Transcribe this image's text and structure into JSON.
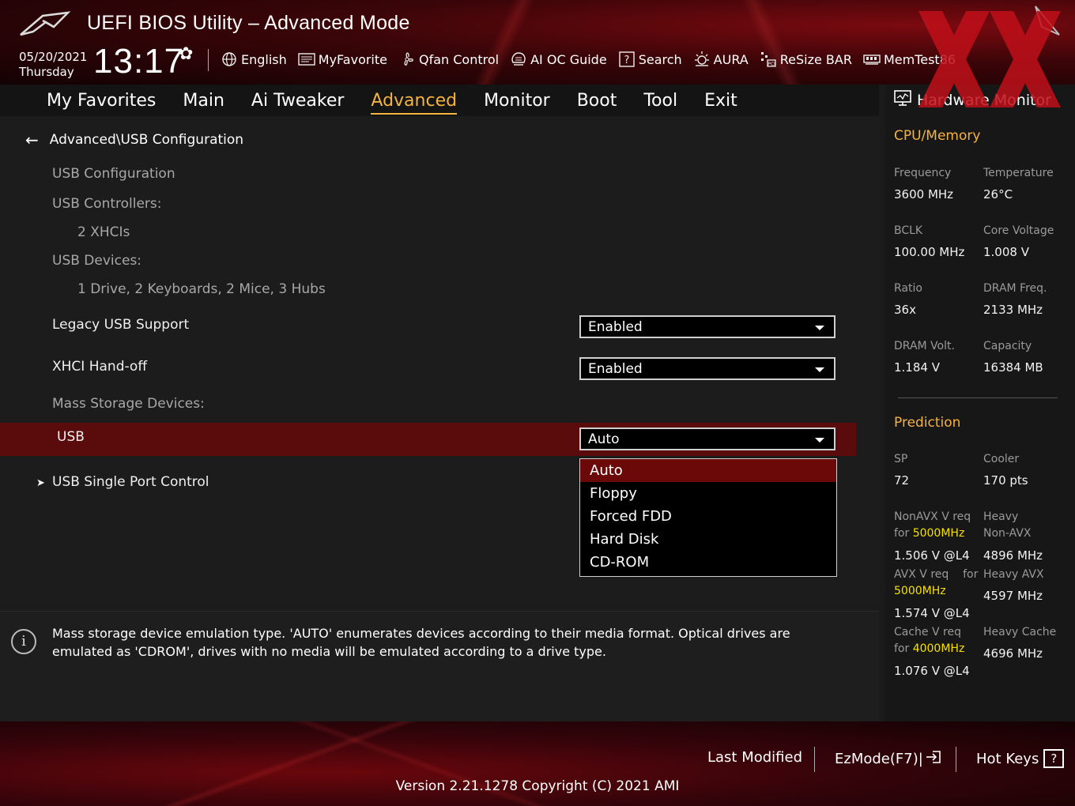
{
  "header": {
    "title": "UEFI BIOS Utility – Advanced Mode",
    "date": "05/20/2021",
    "day": "Thursday",
    "time": "13:17",
    "tools": [
      {
        "label": "English",
        "icon": "globe-icon"
      },
      {
        "label": "MyFavorite",
        "icon": "favorite-icon"
      },
      {
        "label": "Qfan Control",
        "icon": "fan-icon"
      },
      {
        "label": "AI OC Guide",
        "icon": "ai-guide-icon"
      },
      {
        "label": "Search",
        "icon": "search-icon"
      },
      {
        "label": "AURA",
        "icon": "aura-icon"
      },
      {
        "label": "ReSize BAR",
        "icon": "resize-bar-icon"
      },
      {
        "label": "MemTest86",
        "icon": "memtest-icon"
      }
    ]
  },
  "tabs": [
    {
      "label": "My Favorites",
      "active": false
    },
    {
      "label": "Main",
      "active": false
    },
    {
      "label": "Ai Tweaker",
      "active": false
    },
    {
      "label": "Advanced",
      "active": true
    },
    {
      "label": "Monitor",
      "active": false
    },
    {
      "label": "Boot",
      "active": false
    },
    {
      "label": "Tool",
      "active": false
    },
    {
      "label": "Exit",
      "active": false
    }
  ],
  "main": {
    "breadcrumb": "Advanced\\USB Configuration",
    "usb_configuration": "USB Configuration",
    "usb_controllers_label": "USB Controllers:",
    "usb_controllers_value": "2 XHCIs",
    "usb_devices_label": "USB Devices:",
    "usb_devices_value": "1 Drive, 2 Keyboards, 2 Mice, 3 Hubs",
    "legacy_usb": {
      "label": "Legacy USB Support",
      "value": "Enabled"
    },
    "xhci_handoff": {
      "label": "XHCI Hand-off",
      "value": "Enabled"
    },
    "mass_storage_label": "Mass Storage Devices:",
    "usb": {
      "label": "USB",
      "value": "Auto"
    },
    "usb_options": [
      "Auto",
      "Floppy",
      "Forced FDD",
      "Hard Disk",
      "CD-ROM"
    ],
    "usb_single_port": "USB Single Port Control"
  },
  "help": {
    "text": "Mass storage device emulation type. 'AUTO' enumerates devices according to their media format. Optical drives are emulated as 'CDROM', drives with no media will be emulated according to a drive type."
  },
  "hardware_monitor": {
    "title": "Hardware Monitor",
    "cpu_memory": {
      "title": "CPU/Memory",
      "frequency_label": "Frequency",
      "frequency": "3600 MHz",
      "temperature_label": "Temperature",
      "temperature": "26°C",
      "bclk_label": "BCLK",
      "bclk": "100.00 MHz",
      "core_voltage_label": "Core Voltage",
      "core_voltage": "1.008 V",
      "ratio_label": "Ratio",
      "ratio": "36x",
      "dram_freq_label": "DRAM Freq.",
      "dram_freq": "2133 MHz",
      "dram_volt_label": "DRAM Volt.",
      "dram_volt": "1.184 V",
      "capacity_label": "Capacity",
      "capacity": "16384 MB"
    },
    "prediction": {
      "title": "Prediction",
      "sp_label": "SP",
      "sp": "72",
      "cooler_label": "Cooler",
      "cooler": "170 pts",
      "nonavx_req_label": "NonAVX V req",
      "nonavx_for": "for",
      "nonavx_freq": "5000MHz",
      "nonavx_v": "1.506 V @L4",
      "heavy_nonavx_label1": "Heavy",
      "heavy_nonavx_label2": "Non-AVX",
      "heavy_nonavx": "4896 MHz",
      "avx_req_label": "AVX V req",
      "avx_for": "for",
      "avx_freq": "5000MHz",
      "avx_v": "1.574 V @L4",
      "heavy_avx_label": "Heavy AVX",
      "heavy_avx": "4597 MHz",
      "cache_req_label": "Cache V req",
      "cache_for": "for",
      "cache_freq": "4000MHz",
      "cache_v": "1.076 V @L4",
      "heavy_cache_label": "Heavy Cache",
      "heavy_cache": "4696 MHz"
    }
  },
  "footer": {
    "last_modified": "Last Modified",
    "ezmode": "EzMode(F7)|",
    "hot_keys": "Hot Keys",
    "hot_keys_box": "?",
    "version": "Version 2.21.1278 Copyright (C) 2021 AMI"
  },
  "colors": {
    "accent": "#f5b340",
    "highlight_row": "#5a0c0c",
    "selected_option": "#6b0909",
    "frequency_highlight": "#f5e000"
  }
}
